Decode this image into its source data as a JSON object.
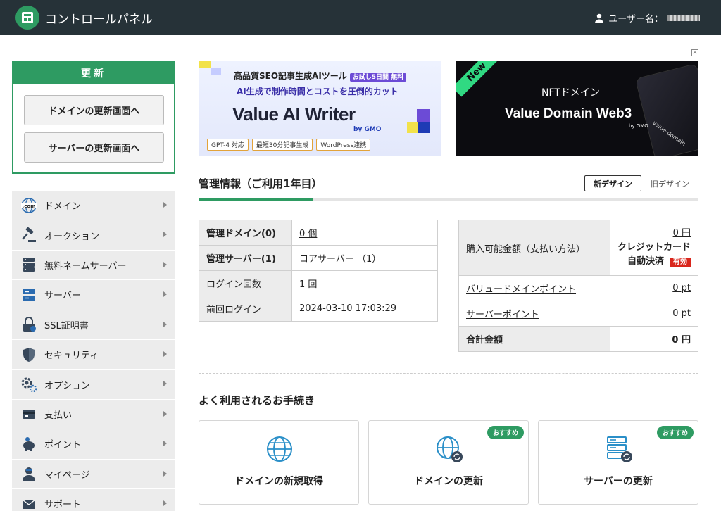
{
  "header": {
    "title": "コントロールパネル",
    "user_label": "ユーザー名："
  },
  "renew": {
    "heading": "更新",
    "domain_button": "ドメインの更新画面へ",
    "server_button": "サーバーの更新画面へ"
  },
  "sidebar": {
    "items": [
      {
        "label": "ドメイン",
        "icon": "globe-com-icon"
      },
      {
        "label": "オークション",
        "icon": "gavel-icon"
      },
      {
        "label": "無料ネームサーバー",
        "icon": "server-stack-icon"
      },
      {
        "label": "サーバー",
        "icon": "server-icon"
      },
      {
        "label": "SSL証明書",
        "icon": "ssl-lock-icon"
      },
      {
        "label": "セキュリティ",
        "icon": "shield-icon"
      },
      {
        "label": "オプション",
        "icon": "gears-icon"
      },
      {
        "label": "支払い",
        "icon": "wallet-icon"
      },
      {
        "label": "ポイント",
        "icon": "piggy-bank-icon"
      },
      {
        "label": "マイページ",
        "icon": "user-icon"
      },
      {
        "label": "サポート",
        "icon": "mail-icon"
      }
    ]
  },
  "banner1": {
    "tagline": "高品質SEO記事生成AIツール",
    "badge": "お試し5日間 無料",
    "subline": "AI生成で制作時間とコストを圧倒的カット",
    "logo": "Value AI Writer",
    "by": "by GMO",
    "chips": [
      "GPT-4 対応",
      "最短30分記事生成",
      "WordPress連携"
    ]
  },
  "banner2": {
    "ribbon": "New",
    "title": "NFTドメイン",
    "logo": "Value Domain Web3",
    "by": "by GMO",
    "card_text": "value-domain"
  },
  "management": {
    "title": "管理情報（ご利用1年目）",
    "new_design": "新デザイン",
    "old_design": "旧デザイン",
    "left_rows": [
      {
        "label": "管理ドメイン(0)",
        "value": "0 個"
      },
      {
        "label": "管理サーバー(1)",
        "value": "コアサーバー （1）"
      },
      {
        "label": "ログイン回数",
        "value": "1 回"
      },
      {
        "label": "前回ログイン",
        "value": "2024-03-10 17:03:29"
      }
    ],
    "balance": {
      "label_prefix": "購入可能金額（",
      "label_link": "支払い方法",
      "label_suffix": "）",
      "amount": "0 円",
      "method": "クレジットカード",
      "auto": "自動決済",
      "status": "有効"
    },
    "points": [
      {
        "label": "バリュードメインポイント",
        "value": "0 pt"
      },
      {
        "label": "サーバーポイント",
        "value": "0 pt"
      }
    ],
    "total": {
      "label": "合計金額",
      "value": "0 円"
    }
  },
  "procedures": {
    "title": "よく利用されるお手続き",
    "recommend": "おすすめ",
    "cards": [
      {
        "label": "ドメインの新規取得"
      },
      {
        "label": "ドメインの更新"
      },
      {
        "label": "サーバーの更新"
      }
    ]
  },
  "colors": {
    "header_bg": "#263238",
    "accent_green": "#2e9b62",
    "badge_red": "#d9261c"
  }
}
